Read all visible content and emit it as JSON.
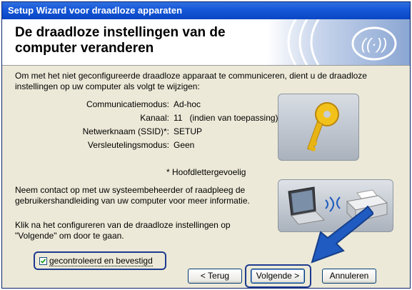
{
  "window": {
    "title": "Setup Wizard voor draadloze apparaten"
  },
  "header": {
    "title": "De draadloze instellingen van de computer veranderen"
  },
  "intro": "Om met het niet geconfigureerde draadloze apparaat te communiceren, dient u de draadloze instellingen op uw computer als volgt te wijzigen:",
  "settings": [
    {
      "label": "Communicatiemodus:",
      "value": "Ad-hoc"
    },
    {
      "label": "Kanaal:",
      "value": "11   (indien van toepassing)"
    },
    {
      "label": "Netwerknaam (SSID)*:",
      "value": "SETUP"
    },
    {
      "label": "Versleutelingsmodus:",
      "value": "Geen"
    }
  ],
  "case_note": "* Hoofdlettergevoelig",
  "contact_text": "Neem contact op met uw systeembeheerder of raadpleeg de gebruikershandleiding van uw computer voor meer informatie.",
  "after_text": "Klik na het configureren van de draadloze instellingen op \"Volgende\" om door te gaan.",
  "checkbox": {
    "label": "gecontroleerd en bevestigd",
    "checked": true
  },
  "buttons": {
    "back": "< Terug",
    "next": "Volgende >",
    "cancel": "Annuleren"
  },
  "icons": [
    "wireless-logo-icon",
    "key-icon",
    "laptop-icon",
    "printer-icon",
    "pointer-arrow-icon"
  ],
  "colors": {
    "titlebar": "#1557d8",
    "highlight_outline": "#1f3b8f",
    "arrow": "#1f5bc0"
  }
}
